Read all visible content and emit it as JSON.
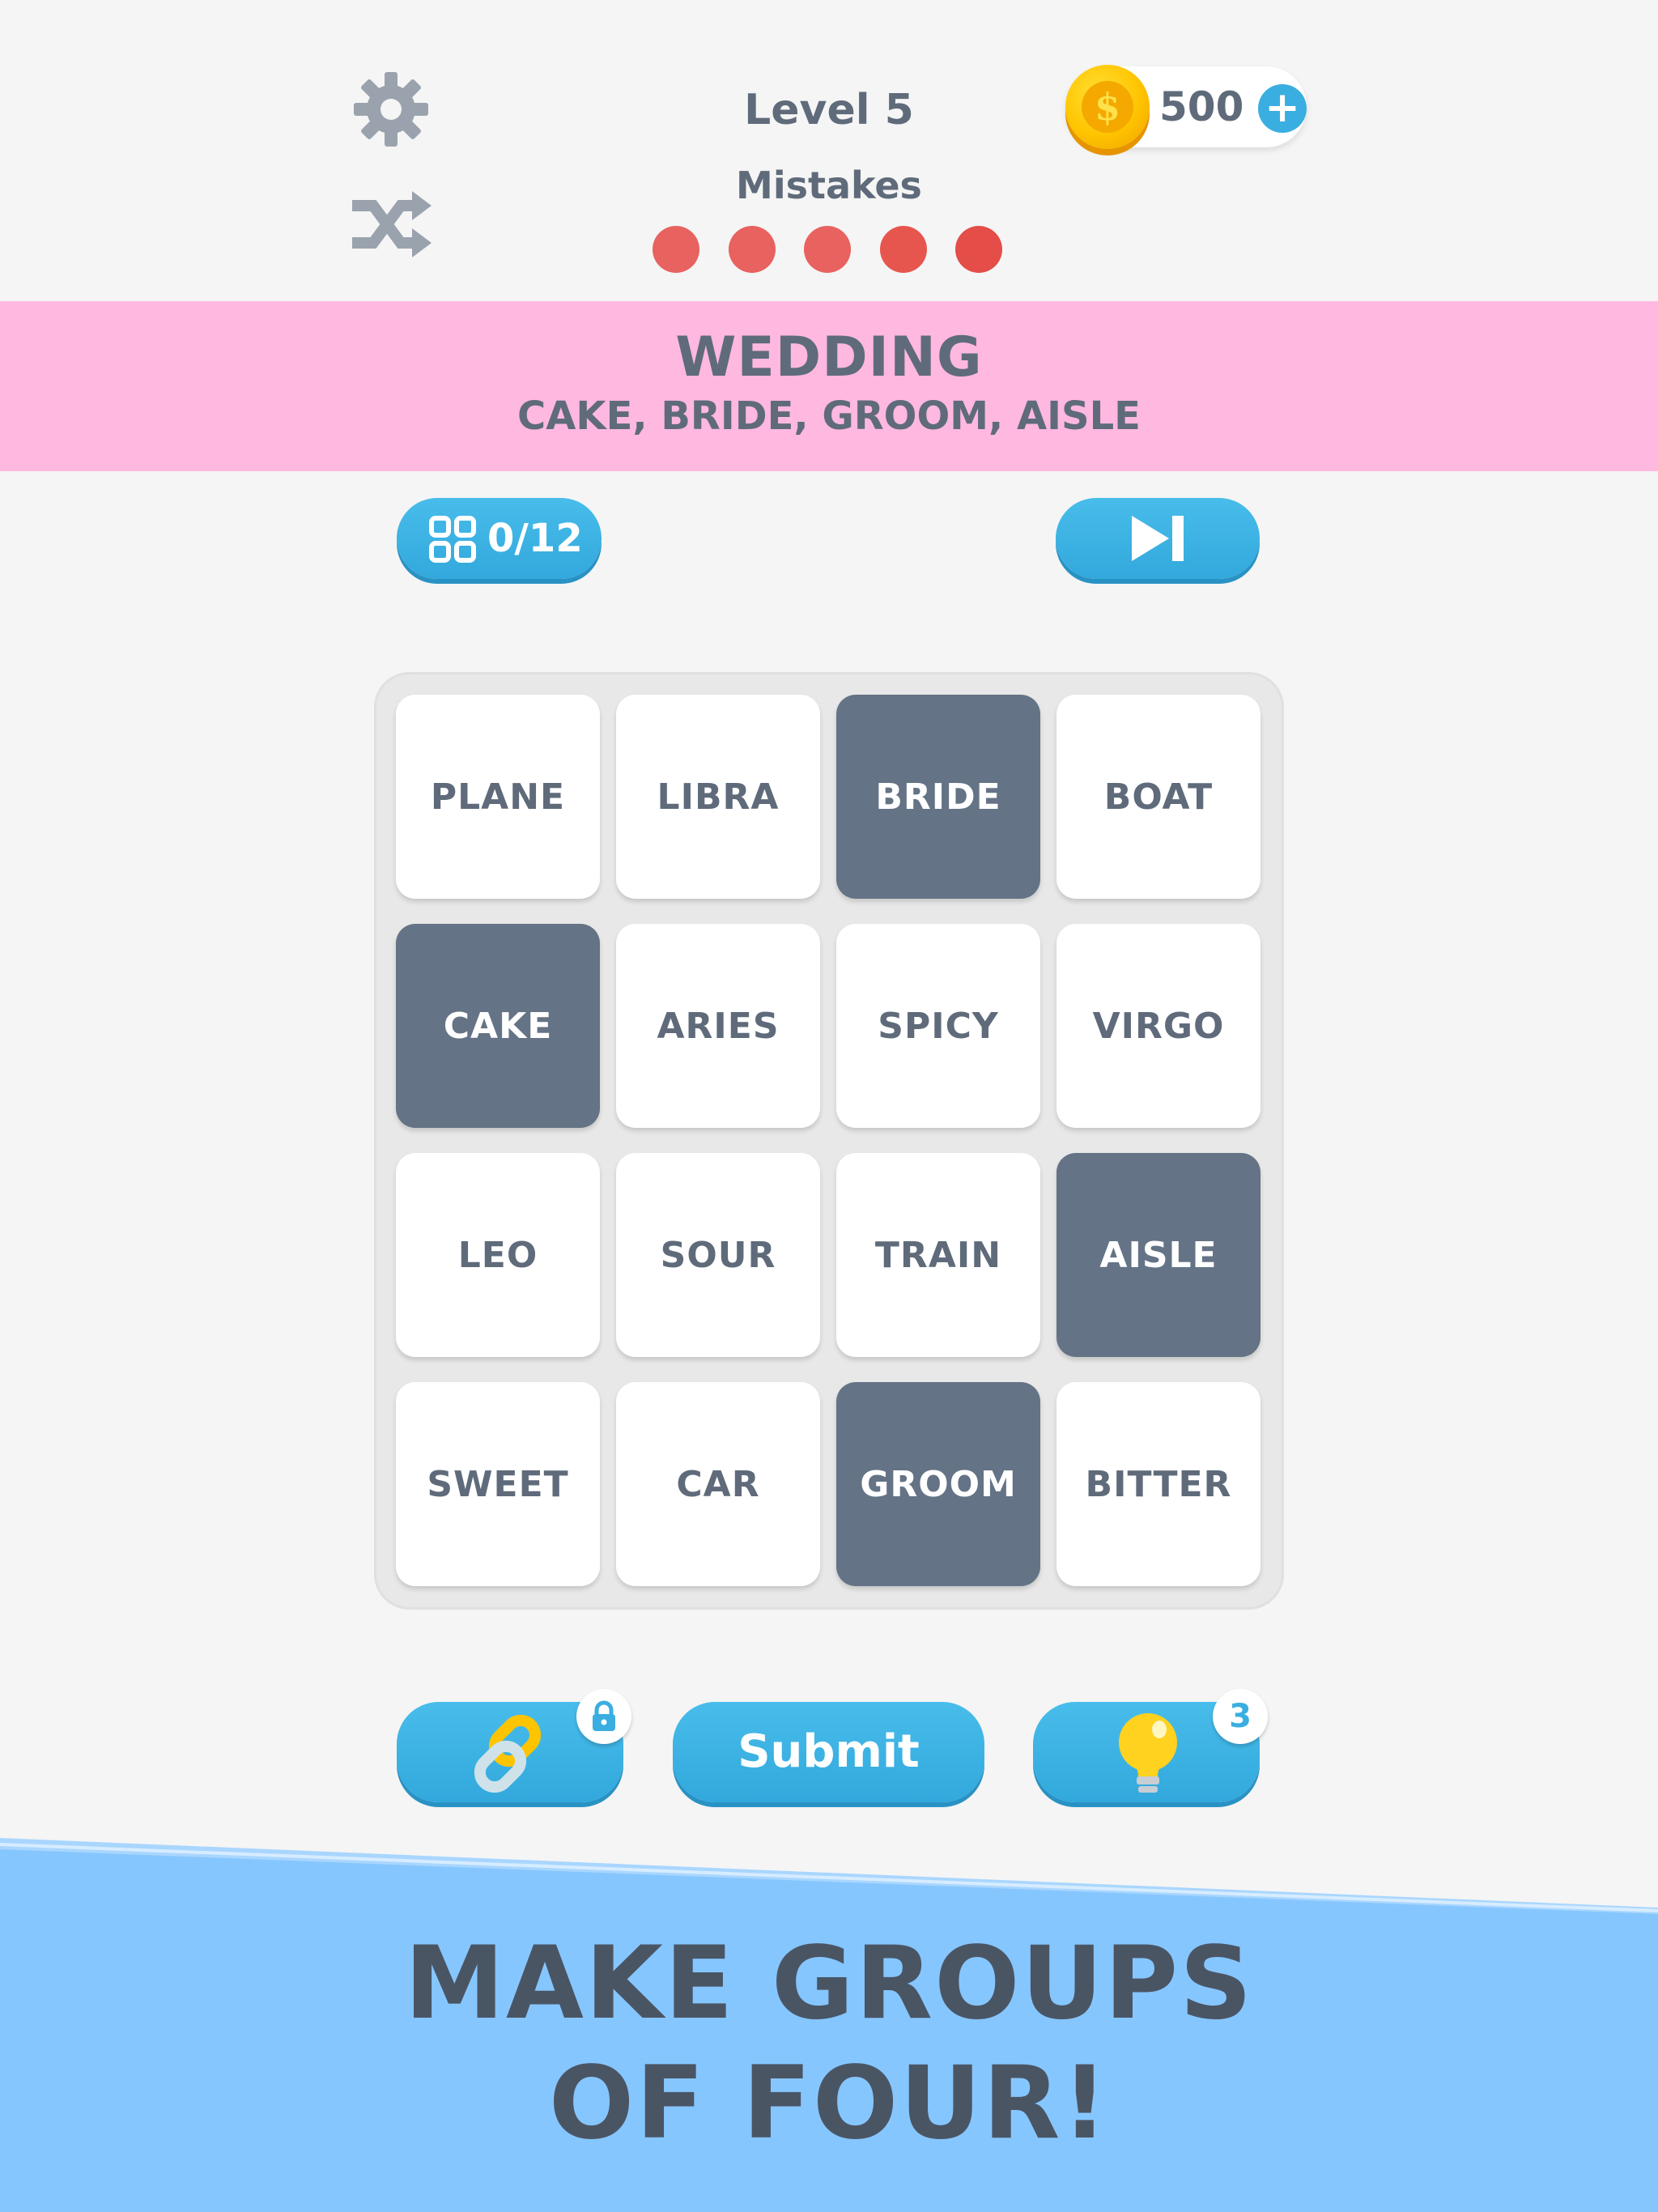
{
  "header": {
    "level_label": "Level 5",
    "mistakes_label": "Mistakes",
    "mistakes_remaining": 5,
    "mistake_dot_colors": [
      "#e8625f",
      "#e8625f",
      "#e8625f",
      "#e6564f",
      "#e44d48"
    ],
    "coins": "500",
    "settings_icon": "gear-icon",
    "shuffle_icon": "shuffle-icon",
    "coin_symbol": "$",
    "add_coins_label": "+"
  },
  "solved_group": {
    "title": "WEDDING",
    "words": "CAKE, BRIDE, GROOM, AISLE",
    "color": "#ffb8e0"
  },
  "progress": {
    "label": "0/12",
    "icon": "grid-icon"
  },
  "skip": {
    "icon": "skip-icon"
  },
  "board": {
    "tiles": [
      {
        "word": "PLANE",
        "selected": false
      },
      {
        "word": "LIBRA",
        "selected": false
      },
      {
        "word": "BRIDE",
        "selected": true
      },
      {
        "word": "BOAT",
        "selected": false
      },
      {
        "word": "CAKE",
        "selected": true
      },
      {
        "word": "ARIES",
        "selected": false
      },
      {
        "word": "SPICY",
        "selected": false
      },
      {
        "word": "VIRGO",
        "selected": false
      },
      {
        "word": "LEO",
        "selected": false
      },
      {
        "word": "SOUR",
        "selected": false
      },
      {
        "word": "TRAIN",
        "selected": false
      },
      {
        "word": "AISLE",
        "selected": true
      },
      {
        "word": "SWEET",
        "selected": false
      },
      {
        "word": "CAR",
        "selected": false
      },
      {
        "word": "GROOM",
        "selected": true
      },
      {
        "word": "BITTER",
        "selected": false
      }
    ]
  },
  "actions": {
    "connect_icon": "chain-link-icon",
    "connect_locked_icon": "lock-icon",
    "submit_label": "Submit",
    "hint_icon": "lightbulb-icon",
    "hint_count": "3"
  },
  "promo": {
    "line1": "MAKE GROUPS",
    "line2": "OF FOUR!",
    "background": "#86c6ff"
  }
}
